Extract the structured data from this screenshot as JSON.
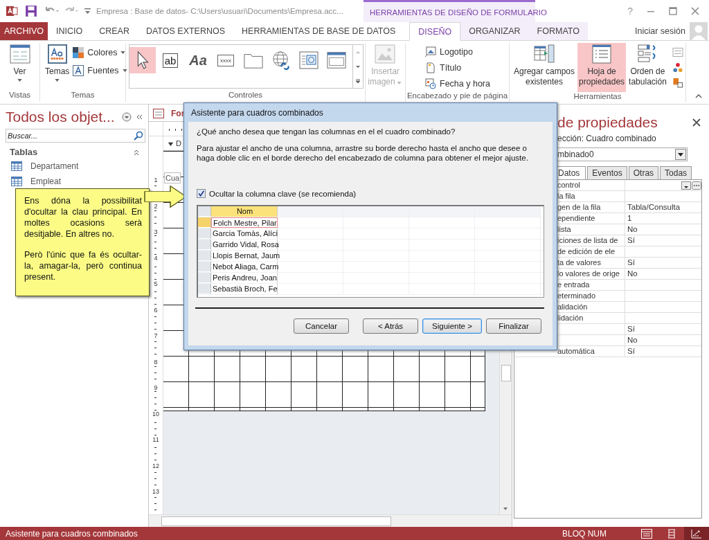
{
  "title_bar": {
    "title": "Empresa : Base de datos- C:\\Users\\usuari\\Documents\\Empresa.acc...",
    "context_tools": "HERRAMIENTAS DE DISEÑO DE FORMULARIO",
    "help": "?"
  },
  "ribbon_tabs": [
    {
      "label": "ARCHIVO",
      "kind": "file",
      "selected": false
    },
    {
      "label": "INICIO",
      "kind": "normal",
      "selected": false
    },
    {
      "label": "CREAR",
      "kind": "normal",
      "selected": false
    },
    {
      "label": "DATOS EXTERNOS",
      "kind": "normal",
      "selected": false
    },
    {
      "label": "HERRAMIENTAS DE BASE DE DATOS",
      "kind": "normal",
      "selected": false
    },
    {
      "label": "DISEÑO",
      "kind": "context",
      "selected": true
    },
    {
      "label": "ORGANIZAR",
      "kind": "context",
      "selected": false
    },
    {
      "label": "FORMATO",
      "kind": "context",
      "selected": false
    }
  ],
  "account": {
    "label": "Iniciar sesión"
  },
  "vistas": {
    "group": "Vistas",
    "button": "Ver"
  },
  "temas": {
    "group": "Temas",
    "button": "Temas",
    "colors": "Colores",
    "fonts": "Fuentes"
  },
  "controles": {
    "group": "Controles",
    "items": [
      {
        "kind": "pointer",
        "selected": true
      },
      {
        "kind": "textbox",
        "glyph": "ab",
        "selected": false
      },
      {
        "kind": "label",
        "glyph": "Aa",
        "selected": false
      },
      {
        "kind": "button",
        "glyph": "xxxx",
        "selected": false
      },
      {
        "kind": "tab",
        "selected": false
      },
      {
        "kind": "hyperlink",
        "selected": false
      },
      {
        "kind": "browser",
        "selected": false
      },
      {
        "kind": "navigation",
        "selected": false
      }
    ]
  },
  "insert_image": {
    "line1": "Insertar",
    "line2": "imagen",
    "disabled": true
  },
  "header_footer": {
    "group": "Encabezado y pie de página",
    "items": [
      {
        "kind": "logo",
        "label": "Logotipo"
      },
      {
        "kind": "title",
        "label": "Título"
      },
      {
        "kind": "datetime",
        "label": "Fecha y hora"
      }
    ]
  },
  "tools": {
    "group": "Herramientas",
    "items": [
      {
        "kind": "add_fields",
        "line1": "Agregar campos",
        "line2": "existentes",
        "selected": false
      },
      {
        "kind": "property_sheet",
        "line1": "Hoja de",
        "line2": "propiedades",
        "selected": true
      },
      {
        "kind": "tab_order",
        "line1": "Orden de",
        "line2": "tabulación",
        "selected": false
      }
    ]
  },
  "nav_pane": {
    "title": "Todos los objet...",
    "search_placeholder": "Buscar...",
    "group": "Tablas",
    "items": [
      {
        "label": "Departament",
        "selected": false
      },
      {
        "label": "Empleat",
        "selected": false
      }
    ]
  },
  "document": {
    "tab": "For",
    "section": "D",
    "control_label": "Cua",
    "ruler": [
      "1",
      "2",
      "3",
      "4",
      "5",
      "6",
      "7",
      "8",
      "9",
      "10",
      "11",
      "12",
      "13"
    ]
  },
  "callout": {
    "paragraphs": [
      "Ens dóna la possibilitat d'ocultar la clau principal. En moltes ocasions serà desitjable. En altres no.",
      "Però l'únic que fa és ocultar-la, amagar-la, però continua present."
    ]
  },
  "dialog": {
    "title": "Asistente para cuadros combinados",
    "question": "¿Qué ancho desea que tengan las columnas en el el cuadro combinado?",
    "instructions": "Para ajustar el ancho de una columna, arrastre su borde derecho hasta el ancho que desee o haga doble clic en el borde derecho del encabezado de columna para obtener el mejor ajuste.",
    "hide_key": {
      "label": "Ocultar la columna clave (se recomienda)",
      "checked": true
    },
    "grid": {
      "column": "Nom",
      "rows": [
        {
          "value": "Folch Mestre, Pilar",
          "selected": true
        },
        {
          "value": "Garcia Tomàs, Alíci",
          "selected": false
        },
        {
          "value": "Garrido Vidal, Rosa",
          "selected": false
        },
        {
          "value": "Llopis Bernat, Jaum",
          "selected": false
        },
        {
          "value": "Nebot Aliaga, Carm",
          "selected": false
        },
        {
          "value": "Peris Andreu, Joan",
          "selected": false
        },
        {
          "value": "Sebastià Broch, Fe",
          "selected": false
        }
      ]
    },
    "buttons": [
      {
        "label": "< Atrás",
        "kind": "normal"
      },
      {
        "label": "Siguiente >",
        "kind": "default"
      },
      {
        "label": "Finalizar",
        "kind": "normal"
      }
    ],
    "cancel": "Cancelar"
  },
  "property_sheet": {
    "title": "de propiedades",
    "selection": "ección:  Cuadro combinado",
    "object": "mbinado0",
    "tabs": [
      {
        "label": "Datos",
        "selected": true
      },
      {
        "label": "Eventos",
        "selected": false
      },
      {
        "label": "Otras",
        "selected": false
      },
      {
        "label": "Todas",
        "selected": false
      }
    ],
    "rows": [
      {
        "name": "control",
        "value": "",
        "kind": "builder"
      },
      {
        "name": "la fila",
        "value": "",
        "kind": "text"
      },
      {
        "name": "gen de la fila",
        "value": "Tabla/Consulta",
        "kind": "text"
      },
      {
        "name": "ependiente",
        "value": "1",
        "kind": "text"
      },
      {
        "name": "lista",
        "value": "No",
        "kind": "text"
      },
      {
        "name": "iciones de lista de",
        "value": "Sí",
        "kind": "text"
      },
      {
        "name": "de edición de ele",
        "value": "",
        "kind": "text"
      },
      {
        "name": "ta de valores",
        "value": "Sí",
        "kind": "text"
      },
      {
        "name": "lo valores de orige",
        "value": "No",
        "kind": "text"
      },
      {
        "name": "e entrada",
        "value": "",
        "kind": "text"
      },
      {
        "name": "eterminado",
        "value": "",
        "kind": "text"
      },
      {
        "name": "alidación",
        "value": "",
        "kind": "text"
      },
      {
        "name": "lidación",
        "value": "",
        "kind": "text"
      },
      {
        "name": "",
        "value": "Sí",
        "kind": "text"
      },
      {
        "name": "",
        "value": "No",
        "kind": "text"
      },
      {
        "name": "automática",
        "value": "Sí",
        "kind": "text"
      }
    ]
  },
  "status_bar": {
    "message": "Asistente para cuadros combinados",
    "indicator": "BLOQ NUM",
    "views": [
      {
        "kind": "form",
        "selected": false
      },
      {
        "kind": "layout",
        "selected": false
      },
      {
        "kind": "design",
        "selected": true
      }
    ]
  }
}
